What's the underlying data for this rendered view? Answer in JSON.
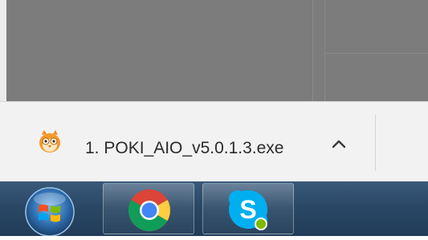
{
  "download": {
    "filename": "1. POKI_AIO_v5.0.1.3.exe",
    "file_icon": "owl-app-icon",
    "expand_icon": "chevron-up-icon"
  },
  "taskbar": {
    "start_icon": "windows-start-orb-icon",
    "apps": [
      {
        "name": "Google Chrome",
        "icon": "chrome-icon"
      },
      {
        "name": "Skype",
        "icon": "skype-icon"
      }
    ]
  },
  "colors": {
    "shelf_background": "#f2f2f2",
    "taskbar": "#2a4866",
    "content_gray": "#7c7c7c"
  }
}
